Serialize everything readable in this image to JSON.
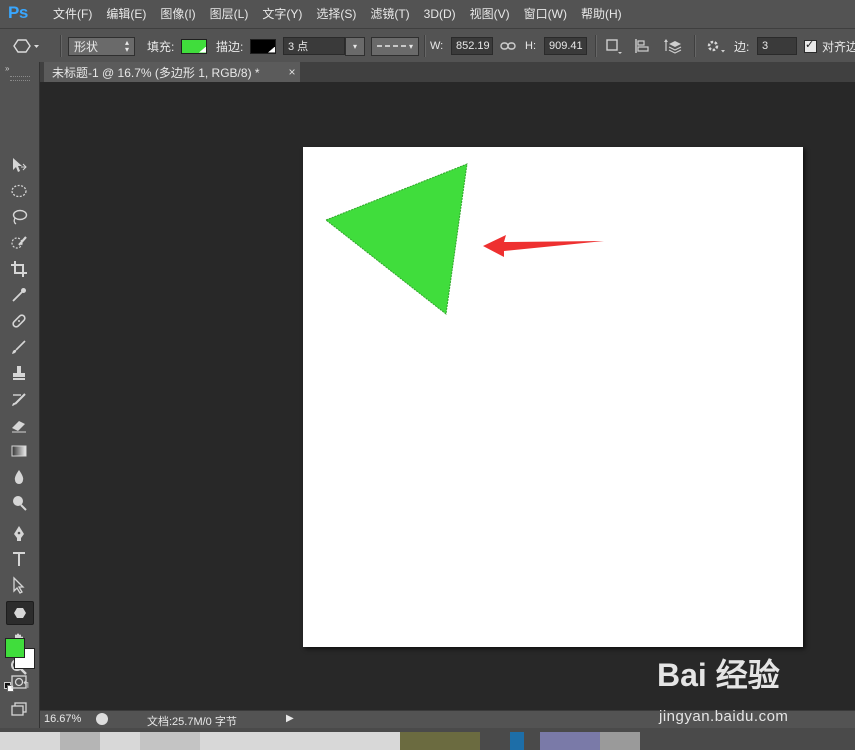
{
  "app": {
    "logo": "Ps"
  },
  "menu": [
    "文件(F)",
    "编辑(E)",
    "图像(I)",
    "图层(L)",
    "文字(Y)",
    "选择(S)",
    "滤镜(T)",
    "3D(D)",
    "视图(V)",
    "窗口(W)",
    "帮助(H)"
  ],
  "options": {
    "mode": "形状",
    "fill_label": "填充:",
    "stroke_label": "描边:",
    "stroke_width": "3 点",
    "w_label": "W:",
    "w_value": "852.19",
    "h_label": "H:",
    "h_value": "909.41",
    "sides_label": "边:",
    "sides_value": "3",
    "align_label": "对齐边",
    "fill_color": "#40dd3c",
    "stroke_color": "#000000"
  },
  "document": {
    "tab_title": "未标题-1 @ 16.7% (多边形 1, RGB/8) *",
    "close_glyph": "×"
  },
  "status": {
    "zoom": "16.67%",
    "doc_info": "文档:25.7M/0 字节"
  },
  "colors": {
    "foreground": "#40dd3c",
    "background": "#ffffff",
    "triangle": "#40dd3c",
    "arrow": "#ee3030"
  },
  "tools": [
    "move-icon",
    "marquee-ellipse-icon",
    "lasso-icon",
    "quick-select-icon",
    "crop-icon",
    "eyedropper-icon",
    "healing-brush-icon",
    "brush-icon",
    "clone-stamp-icon",
    "history-brush-icon",
    "eraser-icon",
    "gradient-icon",
    "blur-icon",
    "dodge-icon",
    "pen-icon",
    "type-icon",
    "path-select-icon",
    "polygon-icon",
    "hand-icon",
    "zoom-icon"
  ],
  "watermark": {
    "brand": "Bai 经验",
    "url": "jingyan.baidu.com"
  }
}
